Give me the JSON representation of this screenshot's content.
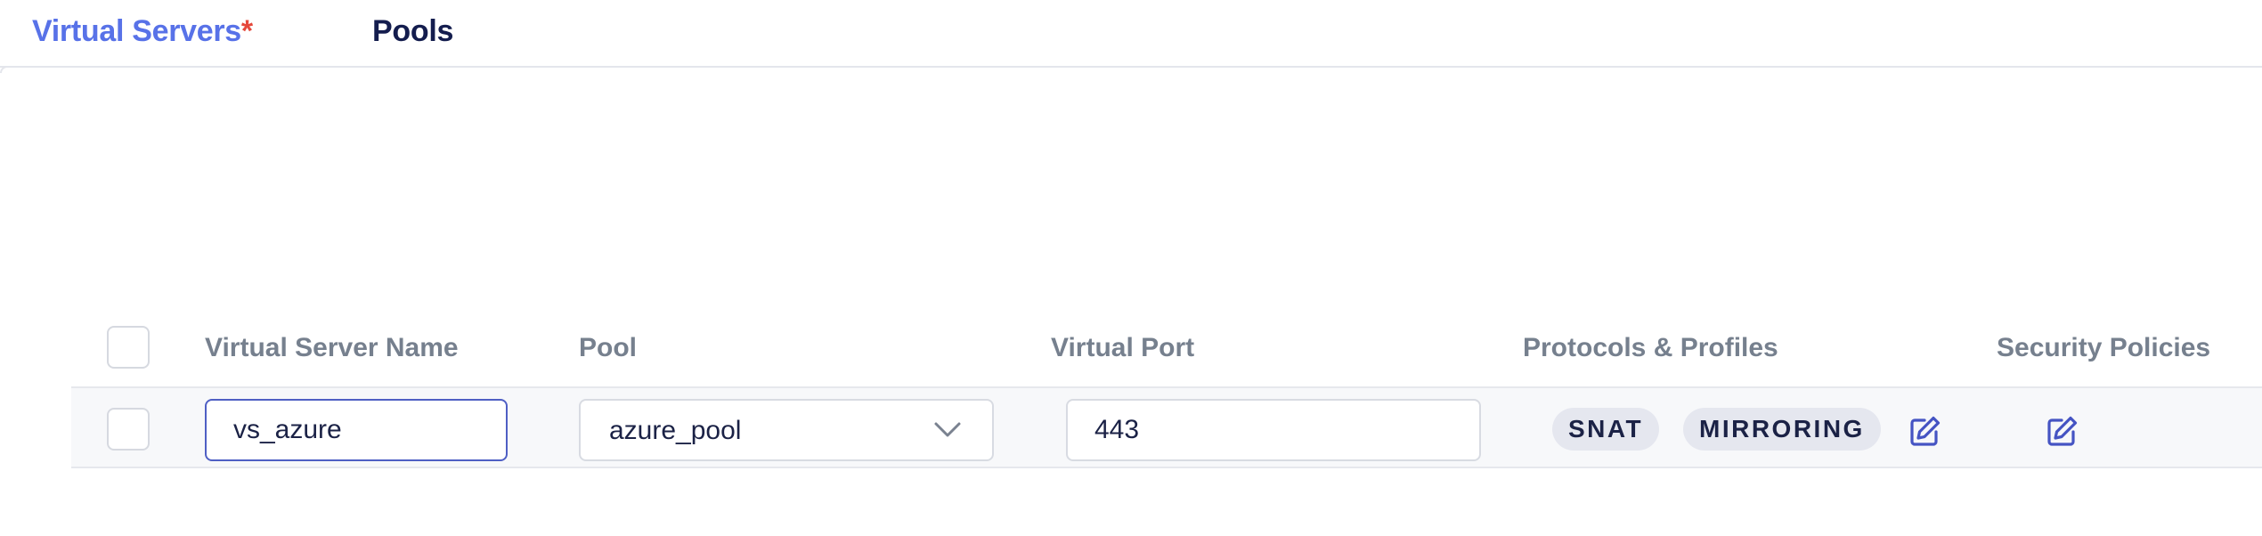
{
  "tabs": {
    "virtual_servers": "Virtual Servers",
    "required_marker": "*",
    "pools": "Pools"
  },
  "table": {
    "headers": {
      "name": "Virtual Server Name",
      "pool": "Pool",
      "port": "Virtual Port",
      "protocols": "Protocols & Profiles",
      "security": "Security Policies"
    },
    "row": {
      "name": "vs_azure",
      "pool": "azure_pool",
      "port": "443",
      "badges": [
        "SNAT",
        "MIRRORING"
      ]
    }
  },
  "colors": {
    "active_tab": "#5872e8",
    "required": "#e5483b",
    "edit_icon": "#4554c3",
    "header_text": "#76808e"
  },
  "icons": {
    "pool_dropdown": "chevron-down-icon",
    "edit": "edit-icon"
  }
}
